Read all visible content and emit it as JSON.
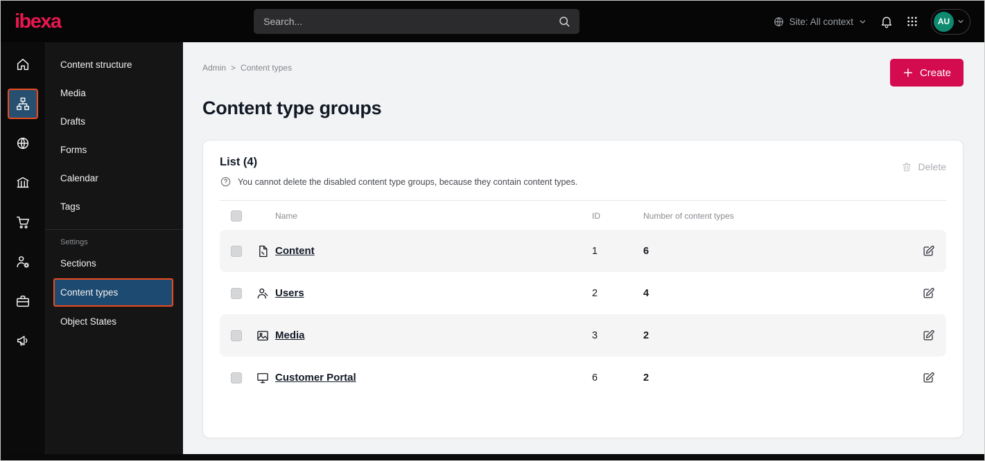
{
  "colors": {
    "brand_red": "#e8174f",
    "create_button_red": "#d40b4e",
    "highlight_orange": "#ee4c1e",
    "active_item_blue": "#1d4a70",
    "avatar_teal": "#0e8a70"
  },
  "topbar": {
    "logo_text": "ibexa",
    "search_placeholder": "Search...",
    "site_context_label": "Site: All context",
    "avatar_initials": "AU"
  },
  "icon_rail": {
    "items": [
      {
        "name": "home",
        "active": false
      },
      {
        "name": "content-tree",
        "active": true
      },
      {
        "name": "site-globe",
        "active": false
      },
      {
        "name": "product-catalog",
        "active": false
      },
      {
        "name": "commerce-cart",
        "active": false
      },
      {
        "name": "admin-users",
        "active": false
      },
      {
        "name": "briefcase",
        "active": false
      },
      {
        "name": "marketing-megaphone",
        "active": false
      }
    ]
  },
  "sidebar": {
    "items": [
      "Content structure",
      "Media",
      "Drafts",
      "Forms",
      "Calendar",
      "Tags"
    ],
    "settings_heading": "Settings",
    "settings_items": [
      "Sections",
      "Content types",
      "Object States"
    ],
    "active_item": "Content types"
  },
  "main": {
    "breadcrumb": {
      "parent": "Admin",
      "separator": ">",
      "current": "Content types"
    },
    "create_button": "Create",
    "page_title": "Content type groups",
    "card": {
      "list_heading": "List (4)",
      "hint_text": "You cannot delete the disabled content type groups, because they contain content types.",
      "delete_button": "Delete",
      "table": {
        "headers": {
          "name": "Name",
          "id": "ID",
          "count": "Number of content types"
        },
        "rows": [
          {
            "icon": "content-file",
            "name": "Content",
            "id": "1",
            "count": "6"
          },
          {
            "icon": "users-person",
            "name": "Users",
            "id": "2",
            "count": "4"
          },
          {
            "icon": "media-image",
            "name": "Media",
            "id": "3",
            "count": "2"
          },
          {
            "icon": "customer-portal-monitor",
            "name": "Customer Portal",
            "id": "6",
            "count": "2"
          }
        ]
      }
    }
  }
}
